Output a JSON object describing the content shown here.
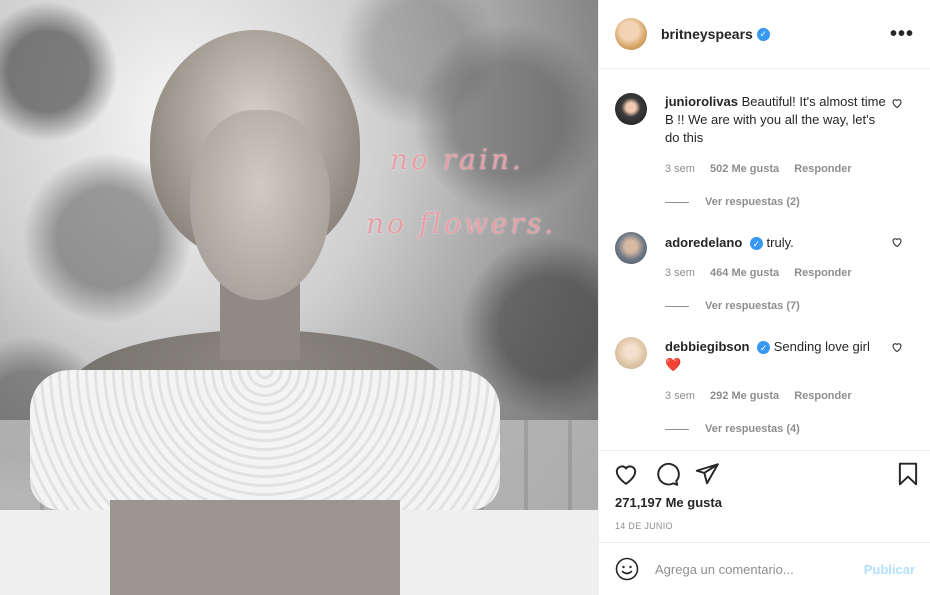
{
  "post": {
    "image_alt": "photo",
    "overlay_line1": "no rain.",
    "overlay_line2": "no flowers."
  },
  "header": {
    "username": "britneyspears",
    "verified_icon": "verified-badge-icon",
    "more_icon": "more-options-icon",
    "more_label": "•••"
  },
  "comments": [
    {
      "username": "juniorolivas",
      "verified": false,
      "text": "Beautiful! It's almost time B !! We are with you all the way, let's do this",
      "age": "3 sem",
      "likes": "502 Me gusta",
      "reply_label": "Responder",
      "view_replies": "Ver respuestas (2)"
    },
    {
      "username": "adoredelano",
      "verified": true,
      "text": "truly.",
      "age": "3 sem",
      "likes": "464 Me gusta",
      "reply_label": "Responder",
      "view_replies": "Ver respuestas (7)"
    },
    {
      "username": "debbiegibson",
      "verified": true,
      "text": "Sending love girl",
      "emoji": "❤️",
      "age": "3 sem",
      "likes": "292 Me gusta",
      "reply_label": "Responder",
      "view_replies": "Ver respuestas (4)"
    }
  ],
  "actions": {
    "like_icon": "heart-icon",
    "comment_icon": "comment-icon",
    "share_icon": "send-icon",
    "save_icon": "bookmark-icon",
    "likes_count": "271,197 Me gusta",
    "date": "14 DE JUNIO"
  },
  "add_comment": {
    "emoji_icon": "emoji-icon",
    "placeholder": "Agrega un comentario...",
    "publish_label": "Publicar"
  },
  "colors": {
    "verified_blue": "#3897f0",
    "heart_red": "#ed4956",
    "publish_disabled": "#b2dffc",
    "overlay_pink": "#e8a0a8"
  }
}
